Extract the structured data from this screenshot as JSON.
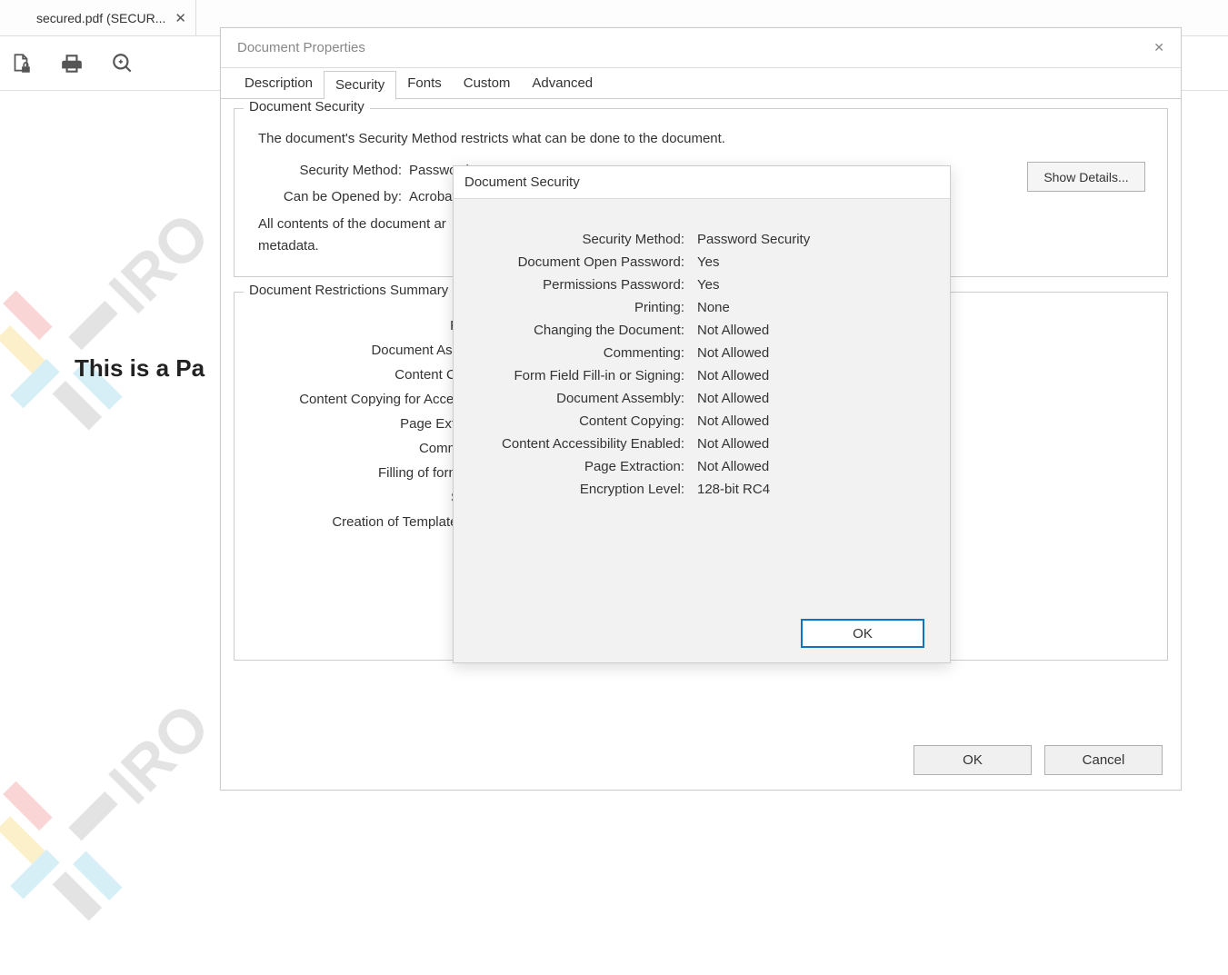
{
  "tab": {
    "title": "secured.pdf (SECUR..."
  },
  "page": {
    "bgText": "This is a Pa"
  },
  "dialog": {
    "title": "Document Properties",
    "tabs": [
      "Description",
      "Security",
      "Fonts",
      "Custom",
      "Advanced"
    ],
    "activeTab": "Security",
    "section1": {
      "legend": "Document Security",
      "desc": "The document's Security Method restricts what can be done to the document.",
      "securityMethodLabel": "Security Method:",
      "securityMethodValue": "Password",
      "canBeOpenedLabel": "Can be Opened by:",
      "canBeOpenedValue": "Acrobat",
      "note1": "All contents of the document ar",
      "note2": "metadata.",
      "showDetails": "Show Details..."
    },
    "section2": {
      "legend": "Document Restrictions Summary",
      "rows": [
        "Print",
        "Document Assem",
        "Content Copy",
        "Content Copying for Accessib",
        "Page Extract",
        "Comment",
        "Filling of form fie",
        "Sign",
        "Creation of Template Pa"
      ]
    },
    "ok": "OK",
    "cancel": "Cancel"
  },
  "dialog2": {
    "title": "Document Security",
    "rows": [
      {
        "label": "Security Method:",
        "value": "Password Security"
      },
      {
        "label": "Document Open Password:",
        "value": "Yes"
      },
      {
        "label": "Permissions Password:",
        "value": "Yes"
      },
      {
        "label": "Printing:",
        "value": "None"
      },
      {
        "label": "Changing the Document:",
        "value": "Not Allowed"
      },
      {
        "label": "Commenting:",
        "value": "Not Allowed"
      },
      {
        "label": "Form Field Fill-in or Signing:",
        "value": "Not Allowed"
      },
      {
        "label": "Document Assembly:",
        "value": "Not Allowed"
      },
      {
        "label": "Content Copying:",
        "value": "Not Allowed"
      },
      {
        "label": "Content Accessibility Enabled:",
        "value": "Not Allowed"
      },
      {
        "label": "Page Extraction:",
        "value": "Not Allowed"
      },
      {
        "label": "Encryption Level:",
        "value": "128-bit RC4"
      }
    ],
    "ok": "OK"
  }
}
